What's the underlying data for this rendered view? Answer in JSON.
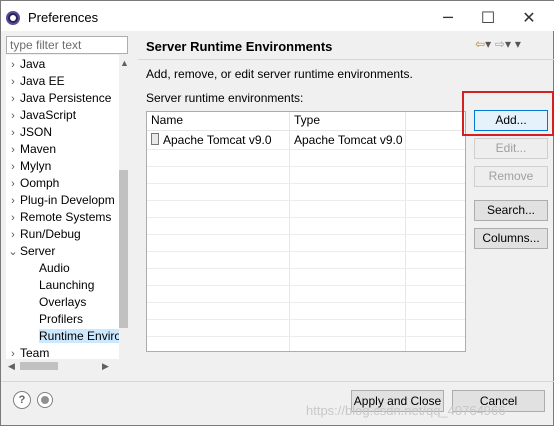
{
  "window": {
    "title": "Preferences"
  },
  "sidebar": {
    "filter_placeholder": "type filter text",
    "items": [
      {
        "label": "Java",
        "expanded": false
      },
      {
        "label": "Java EE",
        "expanded": false
      },
      {
        "label": "Java Persistence",
        "expanded": false
      },
      {
        "label": "JavaScript",
        "expanded": false
      },
      {
        "label": "JSON",
        "expanded": false
      },
      {
        "label": "Maven",
        "expanded": false
      },
      {
        "label": "Mylyn",
        "expanded": false
      },
      {
        "label": "Oomph",
        "expanded": false
      },
      {
        "label": "Plug-in Development",
        "expanded": false
      },
      {
        "label": "Remote Systems",
        "expanded": false
      },
      {
        "label": "Run/Debug",
        "expanded": false
      },
      {
        "label": "Server",
        "expanded": true
      },
      {
        "label": "Audio",
        "child": true
      },
      {
        "label": "Launching",
        "child": true
      },
      {
        "label": "Overlays",
        "child": true
      },
      {
        "label": "Profilers",
        "child": true
      },
      {
        "label": "Runtime Environments",
        "child": true,
        "selected": true
      },
      {
        "label": "Team",
        "expanded": false
      }
    ]
  },
  "main": {
    "title": "Server Runtime Environments",
    "description": "Add, remove, or edit server runtime environments.",
    "list_label": "Server runtime environments:",
    "table": {
      "columns": [
        "Name",
        "Type"
      ],
      "rows": [
        {
          "name": "Apache Tomcat v9.0",
          "type": "Apache Tomcat v9.0"
        }
      ]
    },
    "buttons": {
      "add": "Add...",
      "edit": "Edit...",
      "remove": "Remove",
      "search": "Search...",
      "columns": "Columns..."
    }
  },
  "footer": {
    "apply_close": "Apply and Close",
    "cancel": "Cancel"
  },
  "watermark": "https://blog.csdn.net/qq_40764966",
  "colors": {
    "highlight": "#d42020",
    "selection": "#cce8ff"
  }
}
